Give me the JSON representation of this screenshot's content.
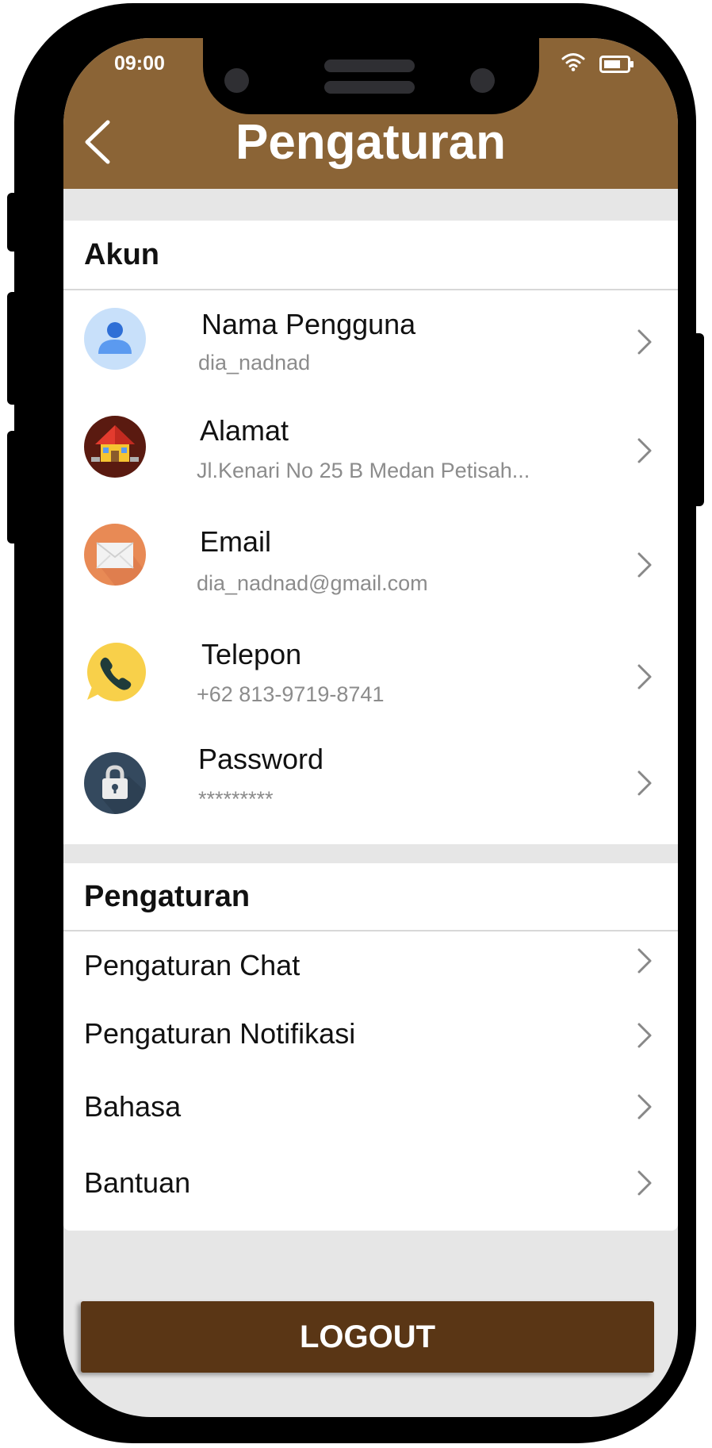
{
  "status_bar": {
    "time": "09:00"
  },
  "header": {
    "title": "Pengaturan"
  },
  "account": {
    "heading": "Akun",
    "items": [
      {
        "title": "Nama Pengguna",
        "value": "dia_nadnad",
        "icon": "user-icon"
      },
      {
        "title": "Alamat",
        "value": "Jl.Kenari No 25 B Medan Petisah...",
        "icon": "house-icon"
      },
      {
        "title": "Email",
        "value": "dia_nadnad@gmail.com",
        "icon": "envelope-icon"
      },
      {
        "title": "Telepon",
        "value": "+62 813-9719-8741",
        "icon": "phone-icon"
      },
      {
        "title": "Password",
        "value": "*********",
        "icon": "lock-icon"
      }
    ]
  },
  "settings": {
    "heading": "Pengaturan",
    "items": [
      {
        "label": "Pengaturan Chat"
      },
      {
        "label": "Pengaturan Notifikasi"
      },
      {
        "label": "Bahasa"
      },
      {
        "label": "Bantuan"
      }
    ]
  },
  "logout": {
    "label": "LOGOUT"
  },
  "colors": {
    "header": "#8b6436",
    "logout_button": "#5a3615",
    "background": "#e6e6e6",
    "secondary_text": "#8c8c8c"
  }
}
